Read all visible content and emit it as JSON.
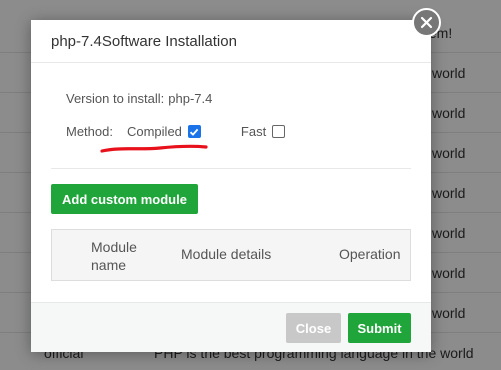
{
  "background": {
    "rows": [
      {
        "name": "",
        "desc": "stem!"
      },
      {
        "name": "",
        "desc": "world"
      },
      {
        "name": "",
        "desc": "world"
      },
      {
        "name": "",
        "desc": "world"
      },
      {
        "name": "",
        "desc": "world"
      },
      {
        "name": "",
        "desc": "world"
      },
      {
        "name": "",
        "desc": "world"
      },
      {
        "name": "",
        "desc": "world"
      },
      {
        "name": "official",
        "desc": "PHP is the best programming language in the world"
      }
    ]
  },
  "dialog": {
    "title": "php-7.4Software Installation",
    "version_label": "Version to install:",
    "version_value": "php-7.4",
    "method_label": "Method:",
    "option_compiled": "Compiled",
    "option_compiled_checked": true,
    "option_fast": "Fast",
    "option_fast_checked": false,
    "add_module_button": "Add custom module",
    "table_headers": {
      "name": "Module name",
      "details": "Module details",
      "operation": "Operation"
    },
    "close_button": "Close",
    "submit_button": "Submit"
  },
  "colors": {
    "primary_green": "#20a53a",
    "checkbox_blue": "#1a73e8",
    "annotation_red": "#e8101a",
    "disabled_gray": "#c8c8c8"
  }
}
